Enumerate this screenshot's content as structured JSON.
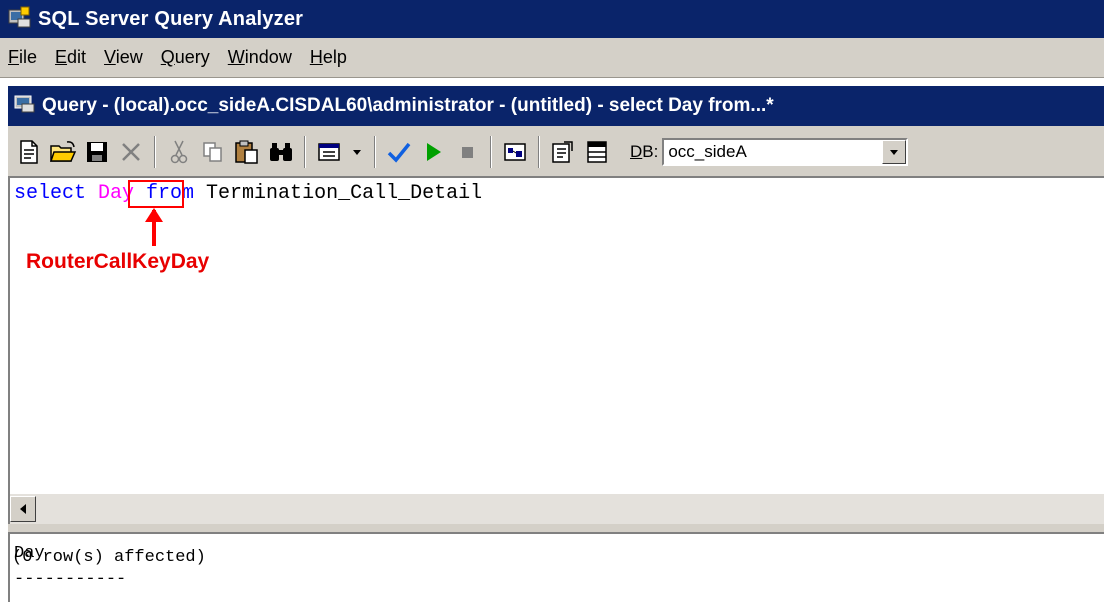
{
  "window": {
    "title": "SQL Server Query Analyzer"
  },
  "menu": [
    {
      "label": "File",
      "mnemonic": "F",
      "rest": "ile"
    },
    {
      "label": "Edit",
      "mnemonic": "E",
      "rest": "dit"
    },
    {
      "label": "View",
      "mnemonic": "V",
      "rest": "iew"
    },
    {
      "label": "Query",
      "mnemonic": "Q",
      "rest": "uery"
    },
    {
      "label": "Window",
      "mnemonic": "W",
      "rest": "indow"
    },
    {
      "label": "Help",
      "mnemonic": "H",
      "rest": "elp"
    }
  ],
  "query_window": {
    "title": "Query - (local).occ_sideA.CISDAL60\\administrator - (untitled) - select Day from...*"
  },
  "toolbar": {
    "db_label_mnemonic": "D",
    "db_label_rest": "B:",
    "db_value": "occ_sideA",
    "icons": [
      "new-query-icon",
      "open-file-icon",
      "save-icon",
      "clear-window-icon",
      "cut-icon",
      "copy-icon",
      "paste-icon",
      "find-icon",
      "results-mode-icon",
      "dropdown-arrow-icon",
      "parse-query-icon",
      "execute-query-icon",
      "cancel-query-icon",
      "execution-plan-icon",
      "object-browser-icon",
      "results-pane-icon"
    ]
  },
  "editor": {
    "kw_select": "select ",
    "column": "Day",
    "kw_from": " from ",
    "table": "Termination_Call_Detail"
  },
  "annotation": {
    "label": "RouterCallKeyDay",
    "color": "#e80000"
  },
  "results": {
    "header": "Day",
    "separator": "-----------",
    "message": "(0 row(s) affected)"
  },
  "colors": {
    "titlebar": "#0a246a",
    "chrome": "#d4d0c8",
    "keyword": "#0000ff",
    "function": "#ff00ff"
  }
}
